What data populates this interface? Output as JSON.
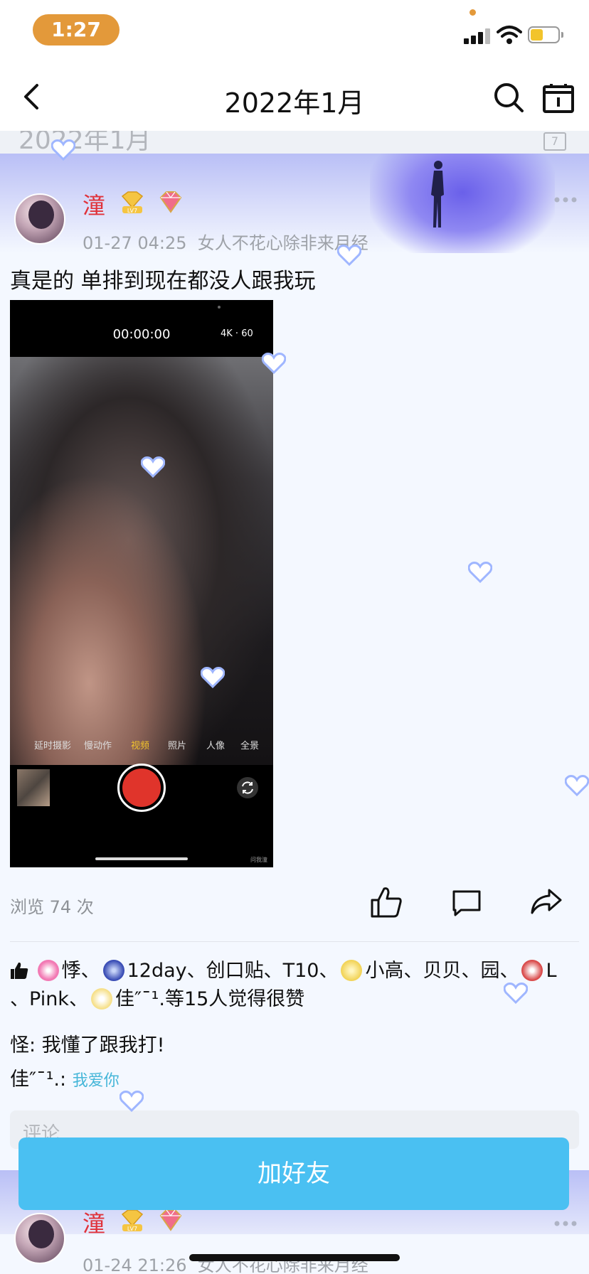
{
  "status_bar": {
    "time": "1:27"
  },
  "nav": {
    "title": "2022年1月"
  },
  "date_strip": {
    "text": "2022年1月",
    "calendar_day": "7"
  },
  "post": {
    "user_name": "潼",
    "badge_level": "LV7",
    "time": "01-27 04:25",
    "signature": "女人不花心除非来月经",
    "text": "真是的 单排到现在都没人跟我玩",
    "video": {
      "timer": "00:00:00",
      "resolution": "4K · 60",
      "modes": [
        "延时摄影",
        "慢动作",
        "视频",
        "照片",
        "人像",
        "全景"
      ],
      "active_mode": "视频",
      "watermark": "问我潼"
    },
    "views": "浏览 74 次",
    "likes": {
      "line1": [
        "悸、",
        "12day、创口贴、T10、",
        "小高、贝贝、园、",
        "L"
      ],
      "line2_prefix": "、Pink、",
      "line2_suffix": "佳″ˉ¹.等15人觉得很赞"
    },
    "comments": [
      {
        "author": "怪",
        "text": ": 我懂了跟我打!"
      },
      {
        "author": "佳″ˉ¹.",
        "text": ": ",
        "styled_text": "我爱你"
      }
    ],
    "comment_placeholder": "评论"
  },
  "add_friend_label": "加好友",
  "post2": {
    "user_name": "潼",
    "badge_level": "LV7",
    "time": "01-24 21:26",
    "signature": "女人不花心除非来月经"
  },
  "colors": {
    "user_name": "#e0323a",
    "add_friend": "#4ac0f2",
    "time_pill": "#e3993a"
  },
  "icons": [
    "back-icon",
    "search-icon",
    "calendar-icon",
    "more-icon",
    "like-icon",
    "comment-icon",
    "share-icon",
    "thumbs-up-icon",
    "heart-icon"
  ]
}
